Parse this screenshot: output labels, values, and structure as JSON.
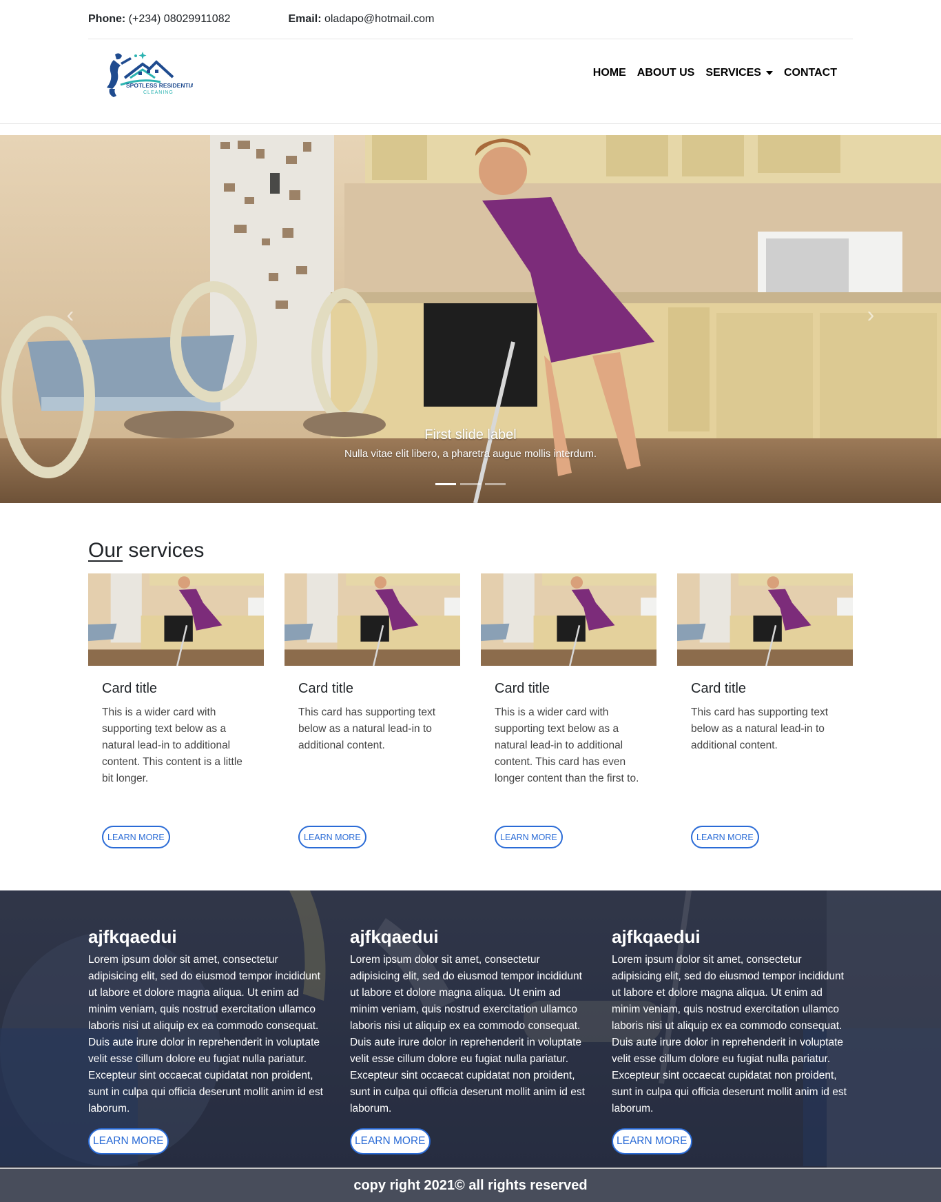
{
  "contact": {
    "phone_key": "Phone:",
    "phone_value": " (+234) 08029911082",
    "email_key": "Email:",
    "email_value": " oladapo@hotmail.com"
  },
  "logo": {
    "line1": "SPOTLESS RESIDENTIAL",
    "line2": "CLEANING"
  },
  "nav": {
    "items": [
      "HOME",
      "ABOUT US",
      "SERVICES",
      "CONTACT"
    ]
  },
  "hero": {
    "caption_title": "First slide label",
    "caption_text": "Nulla vitae elit libero, a pharetra augue mollis interdum.",
    "prev_icon": "chevron-left-icon",
    "next_icon": "chevron-right-icon",
    "prev_glyph": "‹",
    "next_glyph": "›",
    "active_slide": 1,
    "slide_count": 3
  },
  "services": {
    "title_underlined": "Our",
    "title_rest": " services",
    "cards": [
      {
        "title": "Card title",
        "text": "This is a wider card with supporting text below as a natural lead-in to additional content. This content is a little bit longer.",
        "button": "LEARN MORE"
      },
      {
        "title": "Card title",
        "text": "This card has supporting text below as a natural lead-in to additional content.",
        "button": "LEARN MORE"
      },
      {
        "title": "Card title",
        "text": "This is a wider card with supporting text below as a natural lead-in to additional content. This card has even longer content than the first to.",
        "button": "LEARN MORE"
      },
      {
        "title": "Card title",
        "text": "This card has supporting text below as a natural lead-in to additional content.",
        "button": "LEARN MORE"
      }
    ]
  },
  "features": {
    "columns": [
      {
        "heading": "ajfkqaedui",
        "text": "Lorem ipsum dolor sit amet, consectetur adipisicing elit, sed do eiusmod tempor incididunt ut labore et dolore magna aliqua. Ut enim ad minim veniam, quis nostrud exercitation ullamco laboris nisi ut aliquip ex ea commodo consequat. Duis aute irure dolor in reprehenderit in voluptate velit esse cillum dolore eu fugiat nulla pariatur. Excepteur sint occaecat cupidatat non proident, sunt in culpa qui officia deserunt mollit anim id est laborum.",
        "button": "LEARN MORE"
      },
      {
        "heading": "ajfkqaedui",
        "text": "Lorem ipsum dolor sit amet, consectetur adipisicing elit, sed do eiusmod tempor incididunt ut labore et dolore magna aliqua. Ut enim ad minim veniam, quis nostrud exercitation ullamco laboris nisi ut aliquip ex ea commodo consequat. Duis aute irure dolor in reprehenderit in voluptate velit esse cillum dolore eu fugiat nulla pariatur. Excepteur sint occaecat cupidatat non proident, sunt in culpa qui officia deserunt mollit anim id est laborum.",
        "button": "LEARN MORE"
      },
      {
        "heading": "ajfkqaedui",
        "text": "Lorem ipsum dolor sit amet, consectetur adipisicing elit, sed do eiusmod tempor incididunt ut labore et dolore magna aliqua. Ut enim ad minim veniam, quis nostrud exercitation ullamco laboris nisi ut aliquip ex ea commodo consequat. Duis aute irure dolor in reprehenderit in voluptate velit esse cillum dolore eu fugiat nulla pariatur. Excepteur sint occaecat cupidatat non proident, sunt in culpa qui officia deserunt mollit anim id est laborum.",
        "button": "LEARN MORE"
      }
    ]
  },
  "footer": {
    "text": "copy right 2021© all rights reserved"
  },
  "colors": {
    "accent": "#2a6bd6",
    "footer_bg": "#484d5b",
    "dark_overlay": "#2c3347"
  }
}
